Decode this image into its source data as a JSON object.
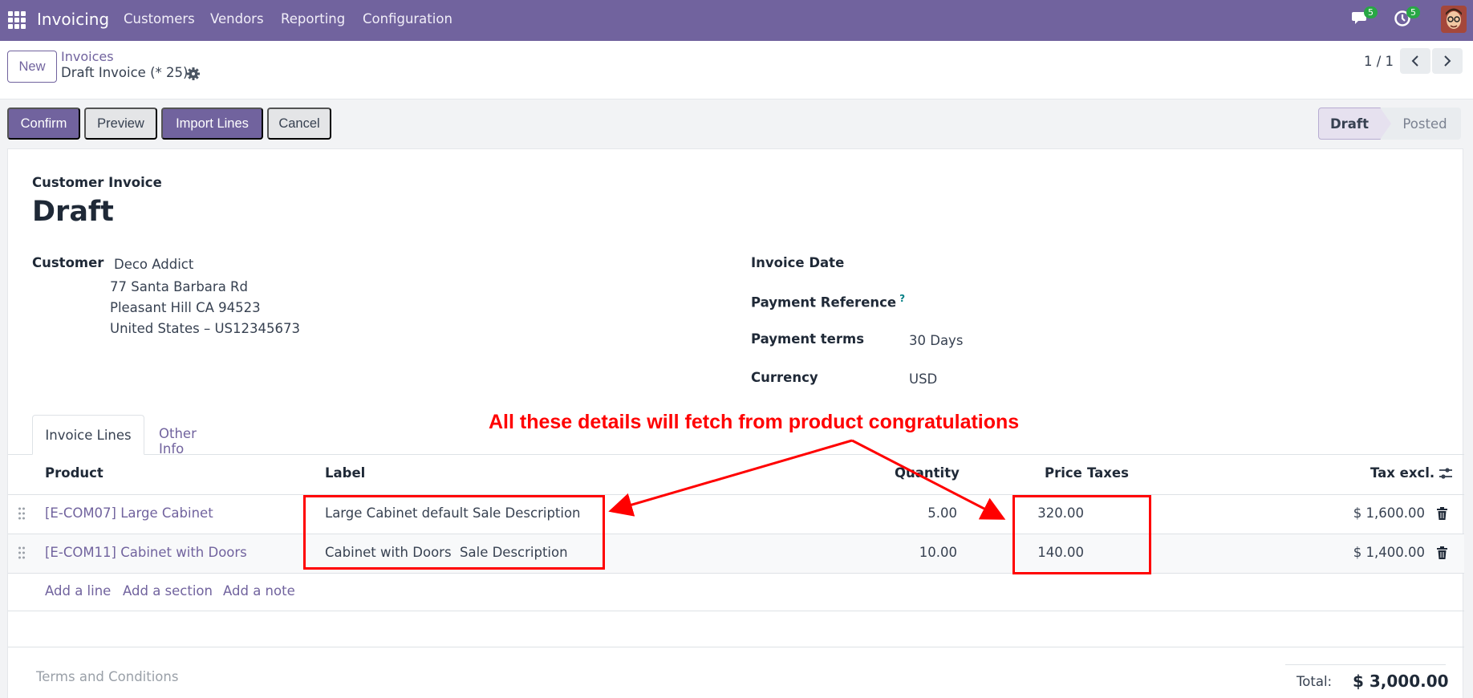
{
  "nav": {
    "app_name": "Invoicing",
    "menu": [
      "Customers",
      "Vendors",
      "Reporting",
      "Configuration"
    ],
    "messages_badge": "5",
    "activities_badge": "5"
  },
  "control": {
    "new_label": "New",
    "breadcrumb_parent": "Invoices",
    "breadcrumb_current": "Draft Invoice (* 25)",
    "pager": "1 / 1"
  },
  "actions": {
    "confirm": "Confirm",
    "preview": "Preview",
    "import_lines": "Import Lines",
    "cancel": "Cancel"
  },
  "status": {
    "draft": "Draft",
    "posted": "Posted"
  },
  "form": {
    "subtitle": "Customer Invoice",
    "title": "Draft",
    "customer_label": "Customer",
    "customer_name": "Deco Addict",
    "address_line1": "77 Santa Barbara Rd",
    "address_line2": "Pleasant Hill CA 94523",
    "address_line3": "United States – US12345673",
    "invoice_date_label": "Invoice Date",
    "payment_reference_label": "Payment Reference",
    "payment_reference_help": "?",
    "payment_terms_label": "Payment terms",
    "payment_terms_value": "30 Days",
    "currency_label": "Currency",
    "currency_value": "USD"
  },
  "tabs": {
    "invoice_lines": "Invoice Lines",
    "other_info": "Other Info"
  },
  "table": {
    "headers": {
      "product": "Product",
      "label": "Label",
      "quantity": "Quantity",
      "price": "Price",
      "taxes": "Taxes",
      "tax_excl": "Tax excl."
    },
    "rows": [
      {
        "product": "[E-COM07] Large Cabinet",
        "label": "Large Cabinet default Sale Description",
        "quantity": "5.00",
        "price": "320.00",
        "subtotal": "$ 1,600.00"
      },
      {
        "product": "[E-COM11] Cabinet with Doors",
        "label": "Cabinet with Doors  Sale Description",
        "quantity": "10.00",
        "price": "140.00",
        "subtotal": "$ 1,400.00"
      }
    ],
    "add_line": "Add a line",
    "add_section": "Add a section",
    "add_note": "Add a note"
  },
  "footer": {
    "terms_placeholder": "Terms and Conditions",
    "total_label": "Total:",
    "total_value": "$ 3,000.00"
  },
  "annotation": {
    "text": "All these details will fetch from product congratulations",
    "color": "#ff0000"
  },
  "colors": {
    "brand": "#71639e",
    "annotation": "#ff0000"
  }
}
